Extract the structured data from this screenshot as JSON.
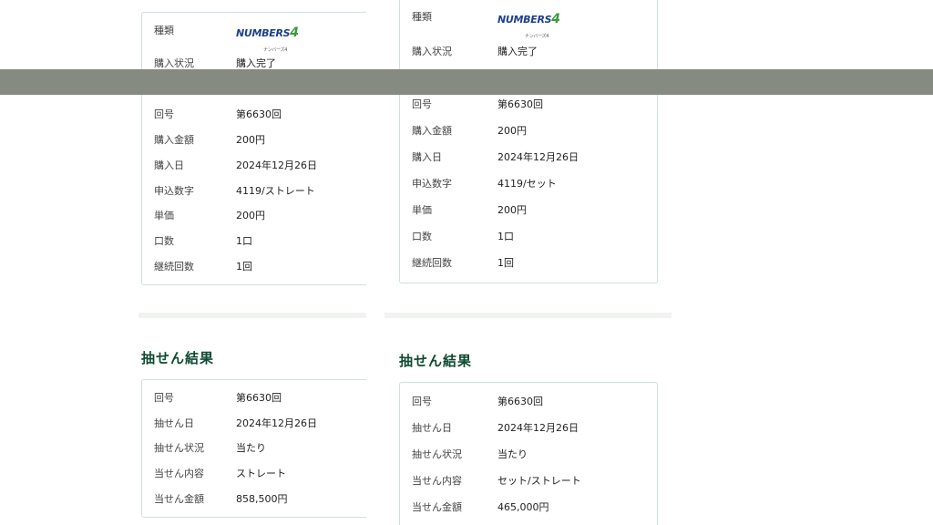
{
  "left": {
    "purchase": {
      "type_label": "種類",
      "logo_text": "NUMBERS",
      "logo_num": "4",
      "logo_sub": "ナンバーズ4",
      "rows": [
        {
          "label": "購入状況",
          "value": "購入完了"
        },
        {
          "label": "回号",
          "value": "第6630回"
        },
        {
          "label": "購入金額",
          "value": "200円"
        },
        {
          "label": "購入日",
          "value": "2024年12月26日"
        },
        {
          "label": "申込数字",
          "value": "4119/ストレート"
        },
        {
          "label": "単価",
          "value": "200円"
        },
        {
          "label": "口数",
          "value": "1口"
        },
        {
          "label": "継続回数",
          "value": "1回"
        }
      ]
    },
    "result_title": "抽せん結果",
    "result": [
      {
        "label": "回号",
        "value": "第6630回"
      },
      {
        "label": "抽せん日",
        "value": "2024年12月26日"
      },
      {
        "label": "抽せん状況",
        "value": "当たり"
      },
      {
        "label": "当せん内容",
        "value": "ストレート"
      },
      {
        "label": "当せん金額",
        "value": "858,500円"
      }
    ]
  },
  "right": {
    "purchase": {
      "type_label": "種類",
      "logo_text": "NUMBERS",
      "logo_num": "4",
      "logo_sub": "ナンバーズ4",
      "rows": [
        {
          "label": "購入状況",
          "value": "購入完了"
        },
        {
          "label": "回号",
          "value": "第6630回"
        },
        {
          "label": "購入金額",
          "value": "200円"
        },
        {
          "label": "購入日",
          "value": "2024年12月26日"
        },
        {
          "label": "申込数字",
          "value": "4119/セット"
        },
        {
          "label": "単価",
          "value": "200円"
        },
        {
          "label": "口数",
          "value": "1口"
        },
        {
          "label": "継続回数",
          "value": "1回"
        }
      ]
    },
    "result_title": "抽せん結果",
    "result": [
      {
        "label": "回号",
        "value": "第6630回"
      },
      {
        "label": "抽せん日",
        "value": "2024年12月26日"
      },
      {
        "label": "抽せん状況",
        "value": "当たり"
      },
      {
        "label": "当せん内容",
        "value": "セット/ストレート"
      },
      {
        "label": "当せん金額",
        "value": "465,000円"
      }
    ]
  },
  "colors": {
    "title": "#0f4a32",
    "border": "#cfe0e3",
    "overlay": "#868b82",
    "logo_blue": "#1d3f8c",
    "logo_green": "#3a9a3c"
  }
}
